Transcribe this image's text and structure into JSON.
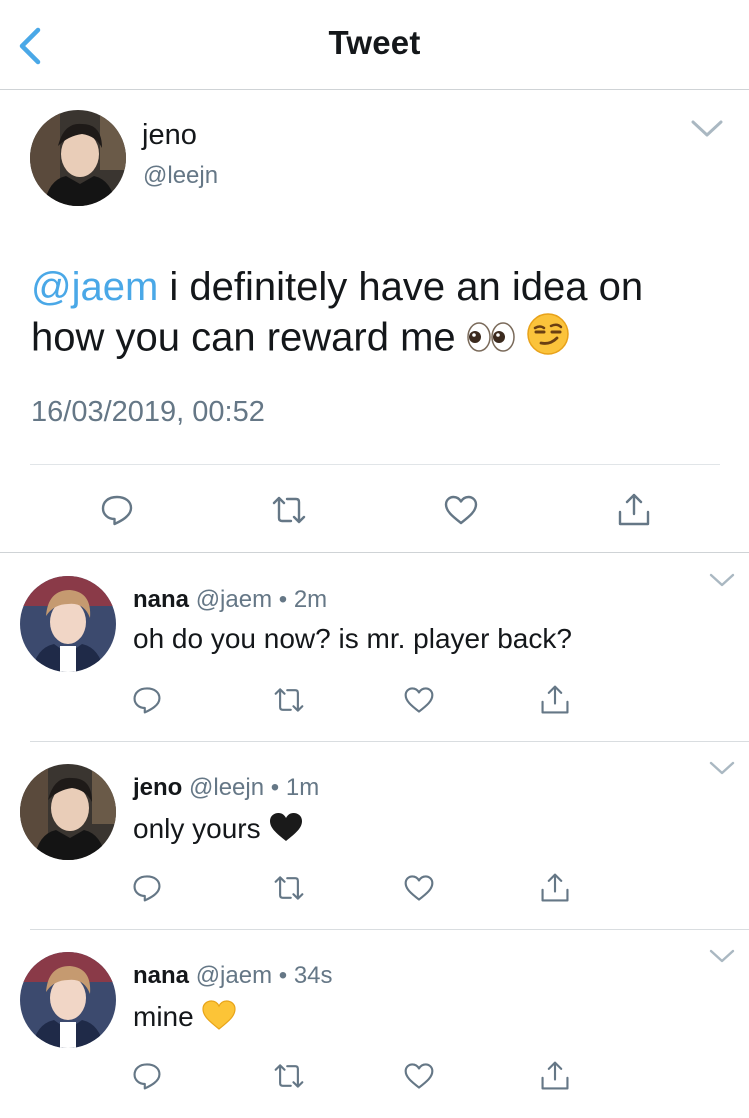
{
  "header": {
    "title": "Tweet",
    "back_icon": "chevron-left-icon"
  },
  "main_tweet": {
    "name": "jeno",
    "handle": "@leejn",
    "mention": "@jaem",
    "text": " i definitely have an idea on how you can reward me ",
    "emojis": [
      "eyes-emoji",
      "smirk-emoji"
    ],
    "timestamp": "16/03/2019, 00:52",
    "actions": [
      "reply-icon",
      "retweet-icon",
      "like-icon",
      "share-icon"
    ]
  },
  "replies": [
    {
      "name": "nana",
      "handle": "@jaem",
      "separator": "•",
      "time": "2m",
      "text": "oh do you now? is mr. player back?",
      "emoji": ""
    },
    {
      "name": "jeno",
      "handle": "@leejn",
      "separator": "•",
      "time": "1m",
      "text": "only yours",
      "emoji": "black-heart-emoji"
    },
    {
      "name": "nana",
      "handle": "@jaem",
      "separator": "•",
      "time": "34s",
      "text": "mine",
      "emoji": "yellow-heart-emoji"
    }
  ],
  "colors": {
    "accent": "#4aa8e7",
    "icon": "#657786",
    "text": "#14171a",
    "divider": "#cfd3d6"
  }
}
